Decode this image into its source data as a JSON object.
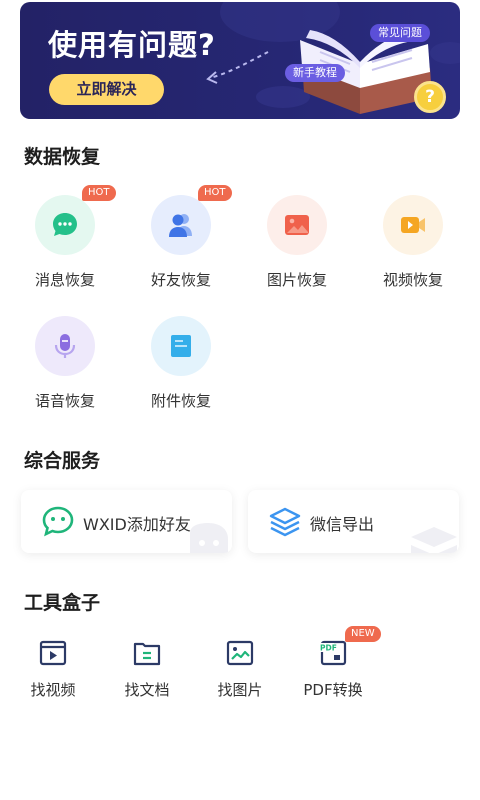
{
  "banner": {
    "title": "使用有问题?",
    "cta_label": "立即解决",
    "tag_faq": "常见问题",
    "tag_guide": "新手教程",
    "coin_symbol": "?"
  },
  "data_recovery": {
    "title": "数据恢复",
    "items": [
      {
        "label": "消息恢复",
        "badge": "HOT",
        "icon": "chat-bubble-icon"
      },
      {
        "label": "好友恢复",
        "badge": "HOT",
        "icon": "contacts-icon"
      },
      {
        "label": "图片恢复",
        "icon": "image-icon"
      },
      {
        "label": "视频恢复",
        "icon": "video-icon"
      },
      {
        "label": "语音恢复",
        "icon": "microphone-icon"
      },
      {
        "label": "附件恢复",
        "icon": "attachment-icon"
      }
    ]
  },
  "services": {
    "title": "综合服务",
    "items": [
      {
        "label": "WXID添加好友",
        "icon": "wechat-icon"
      },
      {
        "label": "微信导出",
        "icon": "layers-icon"
      }
    ]
  },
  "toolbox": {
    "title": "工具盒子",
    "items": [
      {
        "label": "找视频",
        "icon": "video-file-icon"
      },
      {
        "label": "找文档",
        "icon": "document-icon"
      },
      {
        "label": "找图片",
        "icon": "picture-icon"
      },
      {
        "label": "PDF转换",
        "badge": "NEW",
        "icon": "pdf-icon",
        "icon_text": "PDF"
      }
    ]
  },
  "colors": {
    "banner_bg": "#262774",
    "cta_bg": "#ffd86b",
    "badge_bg": "#ef6a4e",
    "icon_navy": "#2c3a66",
    "wechat_green": "#1fb57a",
    "layers_blue": "#3c95f0"
  }
}
